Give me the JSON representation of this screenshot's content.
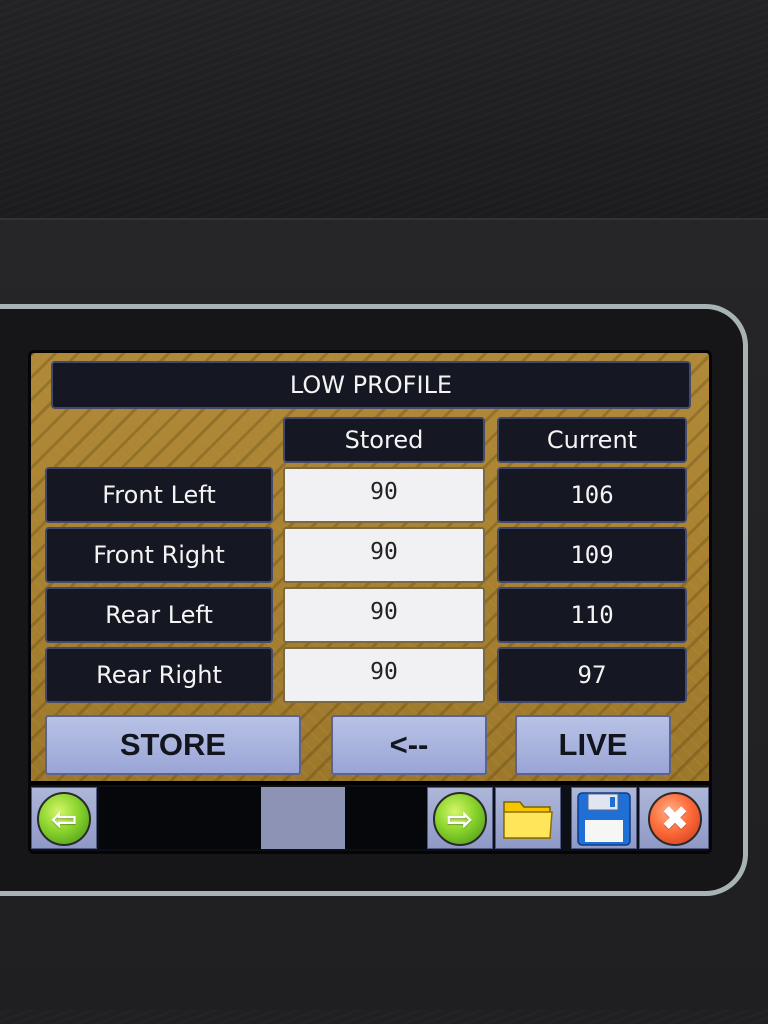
{
  "screen": {
    "title": "LOW PROFILE",
    "columns": {
      "stored": "Stored",
      "current": "Current"
    },
    "rows": [
      {
        "label": "Front Left",
        "stored": "90",
        "current": "106"
      },
      {
        "label": "Front Right",
        "stored": "90",
        "current": "109"
      },
      {
        "label": "Rear Left",
        "stored": "90",
        "current": "110"
      },
      {
        "label": "Rear Right",
        "stored": "90",
        "current": "97"
      }
    ],
    "buttons": {
      "store": "STORE",
      "back": "<--",
      "live": "LIVE"
    }
  },
  "toolbar": {
    "icons": [
      "arrow-left-icon",
      "arrow-right-icon",
      "folder-icon",
      "save-icon",
      "close-icon"
    ]
  },
  "colors": {
    "panel_bg": "#151822",
    "panel_border": "#414a6e",
    "button_bg": "#aab4e0",
    "stored_cell_bg": "#f1f1f3",
    "background_gold": "#a98231"
  }
}
